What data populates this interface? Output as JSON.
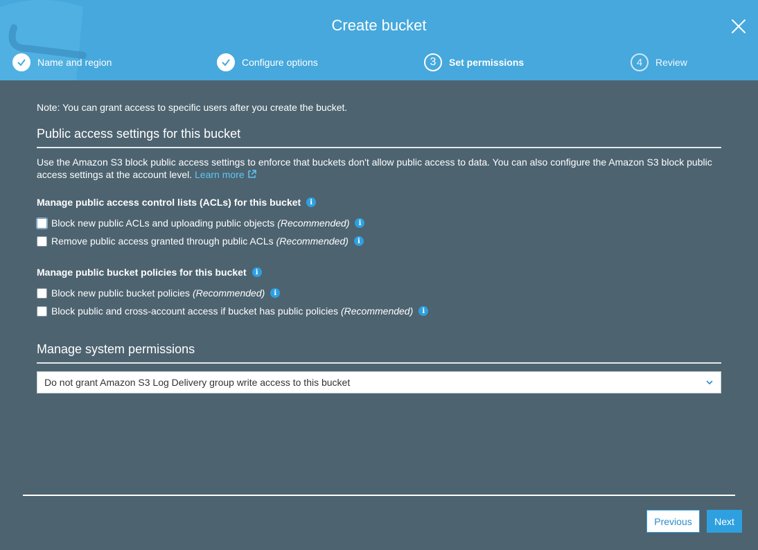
{
  "dialog": {
    "title": "Create bucket"
  },
  "steps": [
    {
      "number": "1",
      "label": "Name and region",
      "state": "done"
    },
    {
      "number": "2",
      "label": "Configure options",
      "state": "done"
    },
    {
      "number": "3",
      "label": "Set permissions",
      "state": "current"
    },
    {
      "number": "4",
      "label": "Review",
      "state": "pending"
    }
  ],
  "note": "Note: You can grant access to specific users after you create the bucket.",
  "public_access": {
    "heading": "Public access settings for this bucket",
    "description": "Use the Amazon S3 block public access settings to enforce that buckets don't allow public access to data. You can also configure the Amazon S3 block public access settings at the account level.",
    "learn_more": "Learn more"
  },
  "acls": {
    "heading": "Manage public access control lists (ACLs) for this bucket",
    "options": [
      {
        "label": "Block new public ACLs and uploading public objects",
        "tag": "(Recommended)",
        "checked": false
      },
      {
        "label": "Remove public access granted through public ACLs",
        "tag": "(Recommended)",
        "checked": false
      }
    ]
  },
  "policies": {
    "heading": "Manage public bucket policies for this bucket",
    "options": [
      {
        "label": "Block new public bucket policies",
        "tag": "(Recommended)",
        "checked": false
      },
      {
        "label": "Block public and cross-account access if bucket has public policies",
        "tag": "(Recommended)",
        "checked": false
      }
    ]
  },
  "system_permissions": {
    "heading": "Manage system permissions",
    "selected": "Do not grant Amazon S3 Log Delivery group write access to this bucket"
  },
  "footer": {
    "previous": "Previous",
    "next": "Next"
  },
  "colors": {
    "header": "#46a8dc",
    "body": "#4d6370",
    "accent": "#2ea0e0",
    "link": "#5fc6f5"
  }
}
